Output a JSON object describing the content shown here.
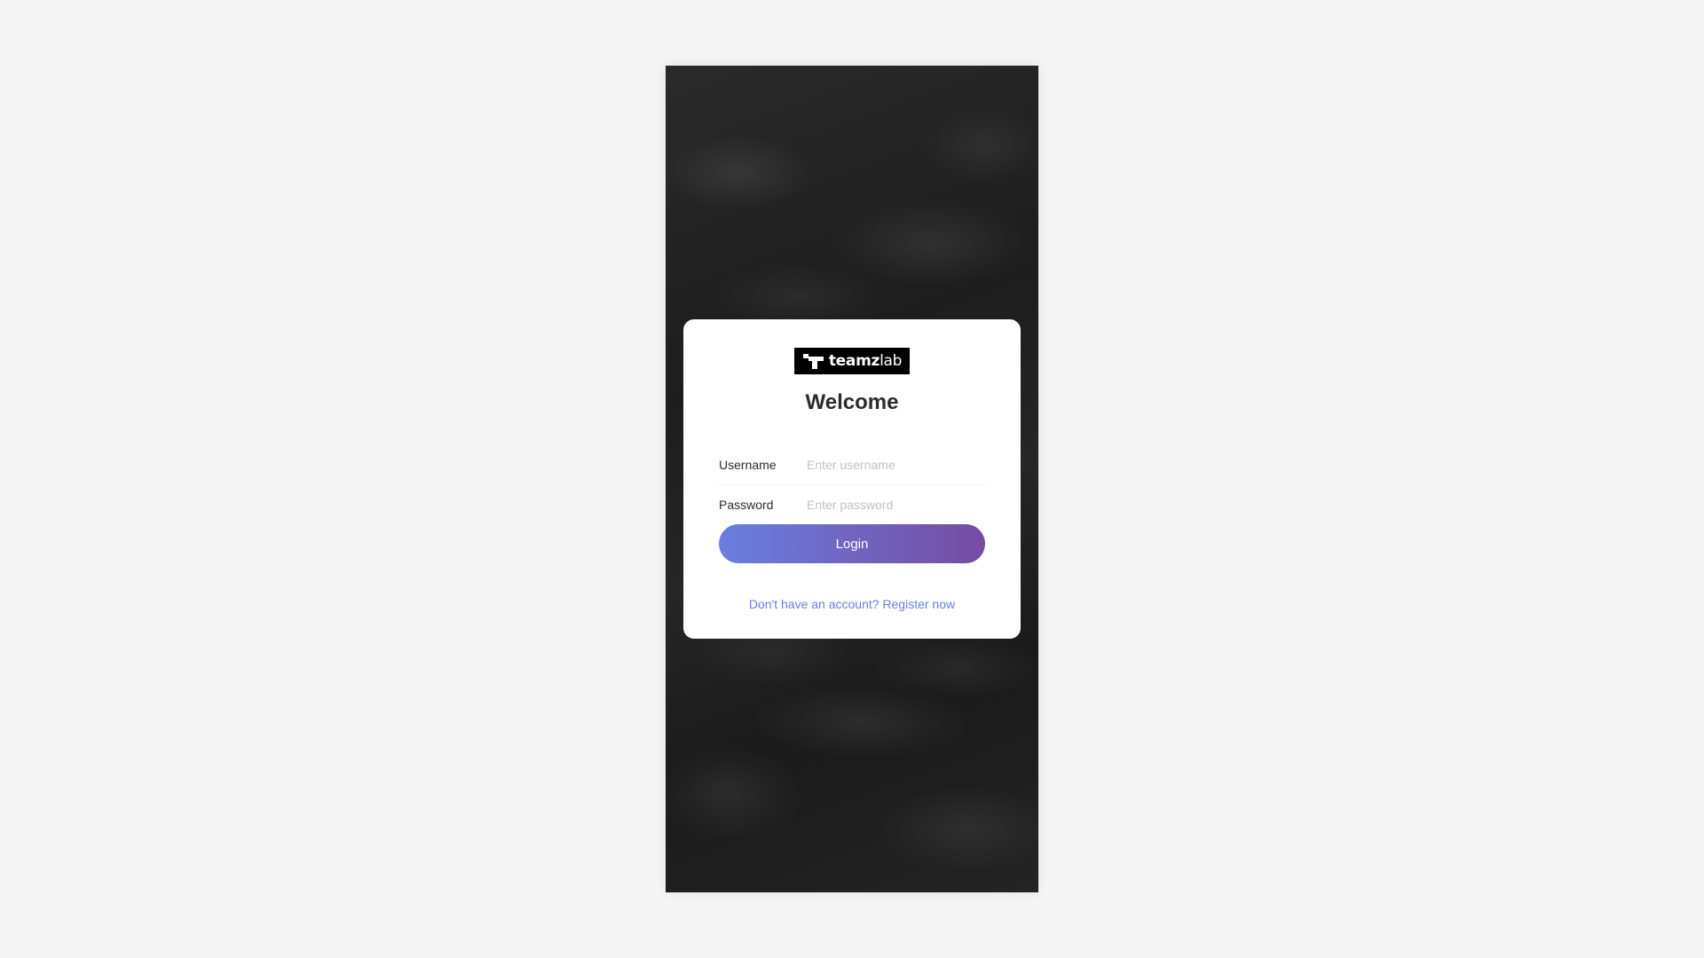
{
  "logo": {
    "text_bold": "teamz",
    "text_light": "lab",
    "icon": "teamzlab-logo-icon"
  },
  "login_card": {
    "title": "Welcome",
    "username": {
      "label": "Username",
      "value": "",
      "placeholder": "Enter username"
    },
    "password": {
      "label": "Password",
      "value": "",
      "placeholder": "Enter password"
    },
    "login_button_label": "Login",
    "register_link": "Don't have an account? Register now"
  },
  "colors": {
    "page_background": "#f5f5f5",
    "card_background": "#ffffff",
    "button_gradient_start": "#6a7fe0",
    "button_gradient_end": "#764ba2",
    "link": "#667eea"
  }
}
